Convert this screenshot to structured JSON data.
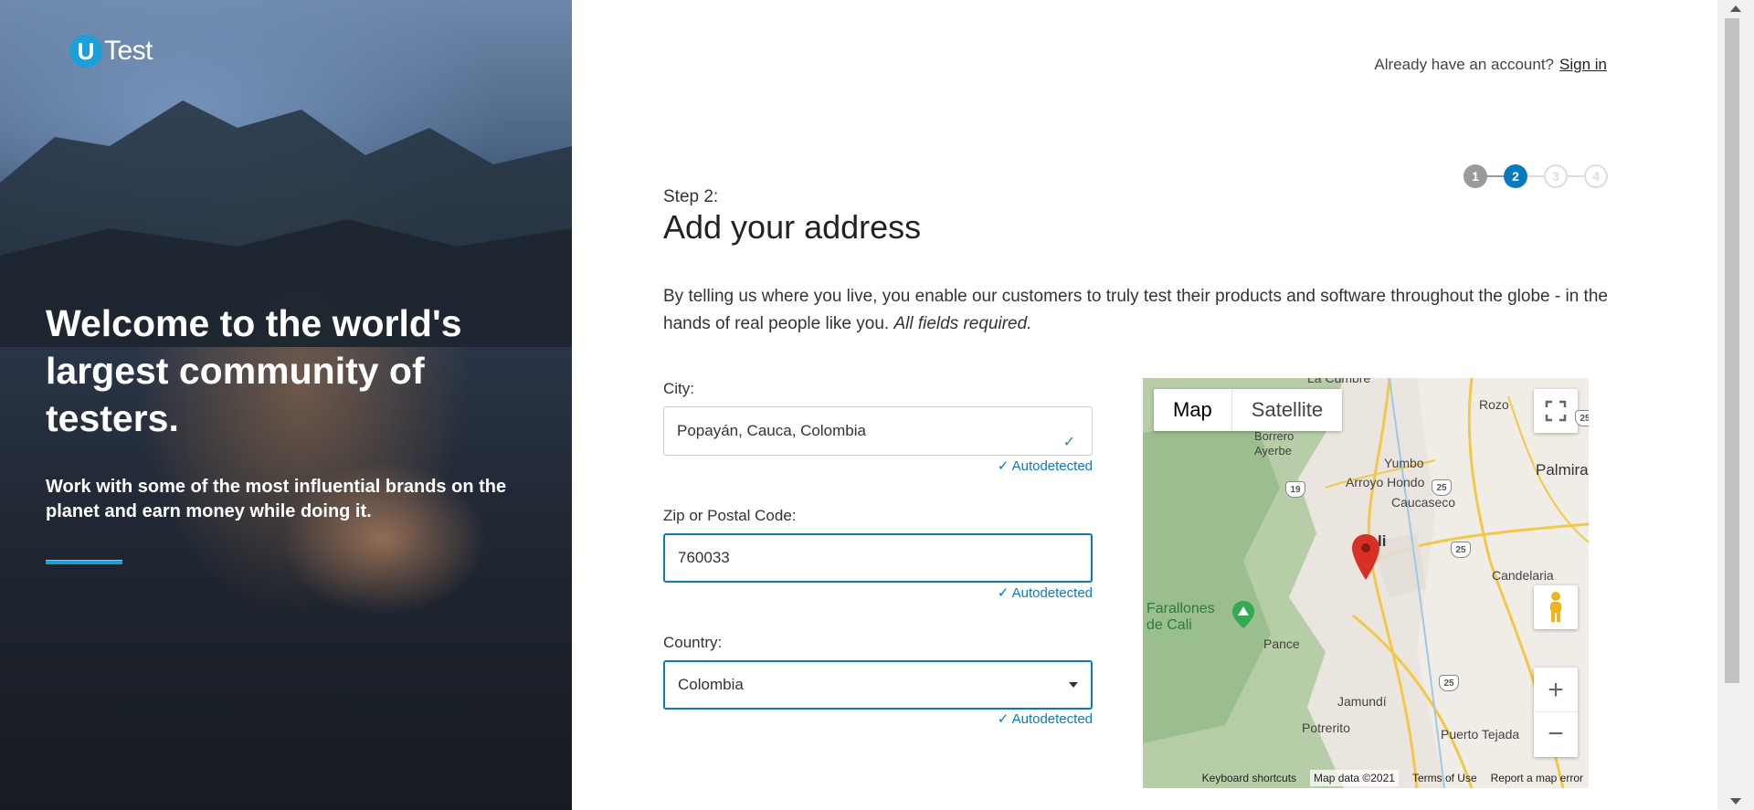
{
  "hero": {
    "logo_u": "U",
    "logo_text": "Test",
    "headline": "Welcome to the world's largest community of testers.",
    "subtext": "Work with some of the most influential brands on the planet and earn money while doing it."
  },
  "header": {
    "signin_prompt": "Already have an account?",
    "signin_link": "Sign in"
  },
  "steps": {
    "items": [
      "1",
      "2",
      "3",
      "4"
    ],
    "current": 2
  },
  "form": {
    "step_label": "Step 2:",
    "title": "Add your address",
    "description": "By telling us where you live, you enable our customers to truly test their products and software throughout the globe - in the hands of real people like you.",
    "description_emphasis": "All fields required.",
    "city_label": "City:",
    "city_value": "Popayán, Cauca, Colombia",
    "zip_label": "Zip or Postal Code:",
    "zip_value": "760033",
    "country_label": "Country:",
    "country_value": "Colombia",
    "autodetected": "✓ Autodetected"
  },
  "map": {
    "tab_map": "Map",
    "tab_satellite": "Satellite",
    "labels": {
      "la_cumbre": "La Cumbre",
      "rozo": "Rozo",
      "palmira": "Palmira",
      "borrero_ayerbe": "Borrero\nAyerbe",
      "yumbo": "Yumbo",
      "arroyo_hondo": "Arroyo Hondo",
      "caucaseco": "Caucaseco",
      "cali": "li",
      "candelaria": "Candelaria",
      "farallones": "Farallones\nde Cali",
      "pance": "Pance",
      "jamundi": "Jamundí",
      "potrerito": "Potrerito",
      "puerto_tejada": "Puerto Tejada"
    },
    "routes": [
      "19",
      "25",
      "25",
      "25",
      "25"
    ],
    "footer": {
      "shortcuts": "Keyboard shortcuts",
      "data": "Map data ©2021",
      "terms": "Terms of Use",
      "report": "Report a map error"
    },
    "zoom_in": "+",
    "zoom_out": "−"
  },
  "colors": {
    "accent": "#0a7abf",
    "brand": "#1aa0d8",
    "step_done": "#9a9a9a",
    "success": "#2a9a6a",
    "pin": "#d93025"
  }
}
